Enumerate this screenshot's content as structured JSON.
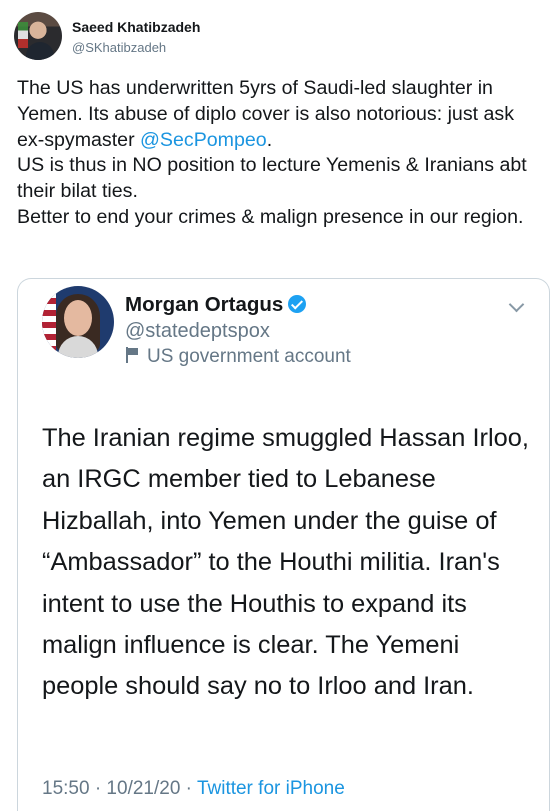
{
  "tweet": {
    "author_name": "Saeed Khatibzadeh",
    "author_handle": "@SKhatibzadeh",
    "text_p1_before": "The US has underwritten 5yrs of Saudi-led slaughter in Yemen. Its abuse of diplo cover is also notorious: just ask ex-spymaster ",
    "mention": "@SecPompeo",
    "text_p1_after": ".",
    "text_p2": "US is thus in NO position to lecture Yemenis & Iranians abt their bilat ties.",
    "text_p3": "Better to end your crimes & malign presence in our region."
  },
  "quoted": {
    "author_name": "Morgan Ortagus",
    "author_handle": "@statedeptspox",
    "account_label": "US government account",
    "text": "The Iranian regime smuggled Hassan Irloo, an IRGC member tied to Lebanese Hizballah, into Yemen under the guise of “Ambassador” to the Houthi militia. Iran's intent to use the Houthis to expand its malign influence is clear. The Yemeni people should say no to Irloo and Iran.",
    "time": "15:50 · 10/21/20 · ",
    "source": "Twitter for iPhone"
  },
  "colors": {
    "link": "#1b95e0",
    "verified": "#1da1f2",
    "secondary_text": "#657786"
  },
  "icons": [
    "avatar",
    "verified-badge-icon",
    "government-flag-icon",
    "chevron-down-icon"
  ]
}
